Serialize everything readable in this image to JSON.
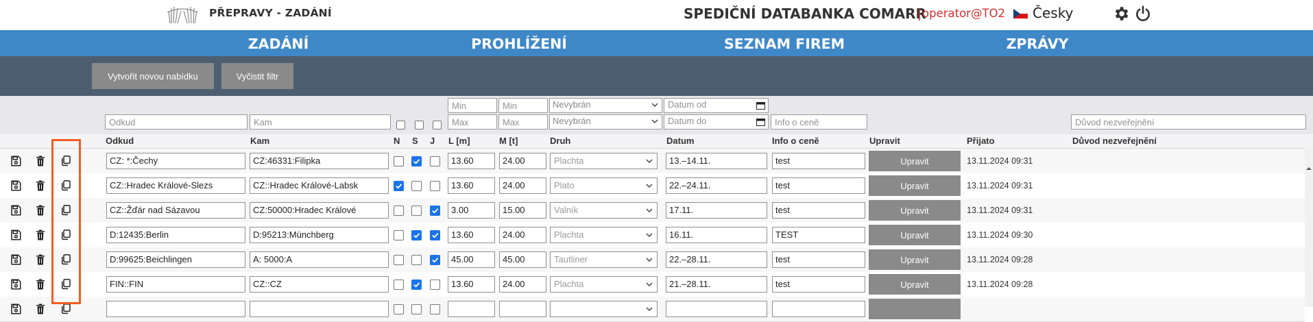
{
  "header": {
    "app_title": "PŘEPRAVY - ZADÁNÍ",
    "db_title": "SPEDIČNÍ DATABANKA COMARR",
    "separator": "|",
    "user": "operator@TO2",
    "language": "Česky"
  },
  "nav": [
    "ZADÁNÍ",
    "PROHLÍŽENÍ",
    "SEZNAM FIREM",
    "ZPRÁVY"
  ],
  "toolbar": {
    "new_offer": "Vytvořit novou nabídku",
    "clear_filter": "Vyčistit filtr"
  },
  "filters": {
    "odkud": "Odkud",
    "kam": "Kam",
    "l_min": "Min",
    "l_max": "Max",
    "m_min": "Min",
    "m_max": "Max",
    "druh_1": "Nevybrán",
    "druh_2": "Nevybrán",
    "datum_od": "Datum od",
    "datum_do": "Datum do",
    "info": "Info o ceně",
    "duvod": "Důvod nezveřejnění"
  },
  "columns": {
    "odkud": "Odkud",
    "kam": "Kam",
    "n": "N",
    "s": "S",
    "j": "J",
    "l": "L [m]",
    "m": "M [t]",
    "druh": "Druh",
    "datum": "Datum",
    "info": "Info o ceně",
    "upravit": "Upravit",
    "prijato": "Přijato",
    "duvod": "Důvod nezveřejnění"
  },
  "rows": [
    {
      "odkud": "CZ: *:Čechy",
      "kam": "CZ:46331:Filipka",
      "n": false,
      "s": true,
      "j": false,
      "l": "13.60",
      "m": "24.00",
      "druh": "Plachta",
      "datum": "13.–14.11.",
      "info": "test",
      "upravit": "Upravit",
      "prijato": "13.11.2024 09:31"
    },
    {
      "odkud": "CZ::Hradec Králové-Slezs",
      "kam": "CZ::Hradec Králové-Labsk",
      "n": true,
      "s": false,
      "j": false,
      "l": "13.60",
      "m": "24.00",
      "druh": "Plato",
      "datum": "22.–24.11.",
      "info": "test",
      "upravit": "Upravit",
      "prijato": "13.11.2024 09:31"
    },
    {
      "odkud": "CZ::Žďár nad Sázavou",
      "kam": "CZ:50000:Hradec Králové",
      "n": false,
      "s": false,
      "j": true,
      "l": "3.00",
      "m": "15.00",
      "druh": "Valník",
      "datum": "17.11.",
      "info": "test",
      "upravit": "Upravit",
      "prijato": "13.11.2024 09:31"
    },
    {
      "odkud": "D:12435:Berlin",
      "kam": "D:95213:Münchberg",
      "n": false,
      "s": true,
      "j": true,
      "l": "13.60",
      "m": "24.00",
      "druh": "Plachta",
      "datum": "16.11.",
      "info": "TEST",
      "upravit": "Upravit",
      "prijato": "13.11.2024 09:30"
    },
    {
      "odkud": "D:99625:Beichlingen",
      "kam": "A: 5000:A",
      "n": false,
      "s": false,
      "j": true,
      "l": "45.00",
      "m": "45.00",
      "druh": "Tautliner",
      "datum": "22.–28.11.",
      "info": "test",
      "upravit": "Upravit",
      "prijato": "13.11.2024 09:28"
    },
    {
      "odkud": "FIN::FIN",
      "kam": "CZ::CZ",
      "n": false,
      "s": true,
      "j": false,
      "l": "13.60",
      "m": "24.00",
      "druh": "Plachta",
      "datum": "21.–28.11.",
      "info": "test",
      "upravit": "Upravit",
      "prijato": "13.11.2024 09:28"
    },
    {
      "odkud": "",
      "kam": "",
      "n": false,
      "s": false,
      "j": false,
      "l": "",
      "m": "",
      "druh": "",
      "datum": "",
      "info": "",
      "upravit": "",
      "prijato": ""
    }
  ],
  "colors": {
    "nav": "#3f88c8",
    "toolbar": "#4d5e70",
    "highlight": "#f45d22",
    "accent_red": "#d32f2f",
    "checkbox": "#1a73e8"
  },
  "icons": {
    "save": "save-icon",
    "delete": "trash-icon",
    "copy": "copy-icon"
  }
}
